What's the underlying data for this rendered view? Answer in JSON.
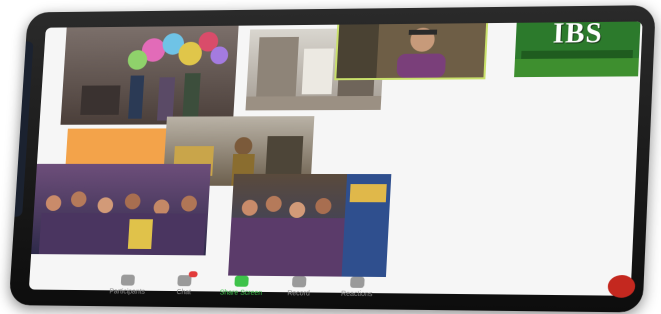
{
  "toolbar": {
    "items": [
      {
        "label": "Participants",
        "icon": "participants-icon"
      },
      {
        "label": "Chat",
        "icon": "chat-icon",
        "badge": true
      },
      {
        "label": "Share Screen",
        "icon": "share-screen-icon",
        "active": true
      },
      {
        "label": "Record",
        "icon": "record-icon"
      },
      {
        "label": "Reactions",
        "icon": "reactions-icon"
      }
    ],
    "end_icon": "end-call-icon"
  },
  "ibs_tile": {
    "text": "IBS"
  },
  "colors": {
    "accent_green": "#3ec24a",
    "end_red": "#c4281f",
    "ibs_green": "#2c7a2c",
    "orange_tile": "#f3a34a"
  }
}
